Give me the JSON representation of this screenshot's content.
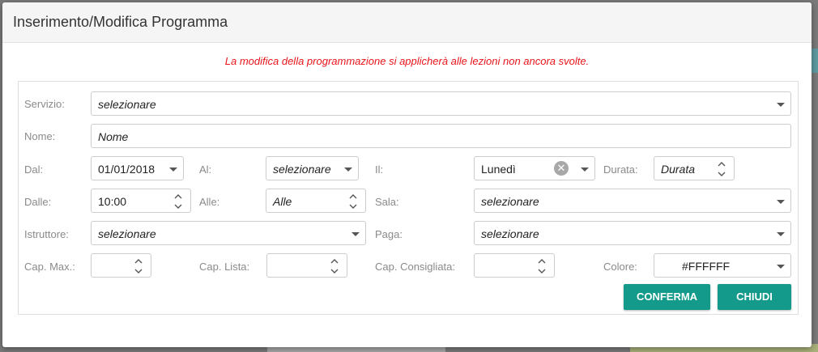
{
  "dialog": {
    "title": "Inserimento/Modifica Programma",
    "notice": "La modifica della programmazione si applicherà alle lezioni non ancora svolte."
  },
  "form": {
    "servizio": {
      "label": "Servizio:",
      "value": "selezionare"
    },
    "nome": {
      "label": "Nome:",
      "placeholder": "Nome"
    },
    "dal": {
      "label": "Dal:",
      "value": "01/01/2018"
    },
    "al": {
      "label": "Al:",
      "value": "selezionare"
    },
    "il": {
      "label": "Il:",
      "value": "Lunedì"
    },
    "durata": {
      "label": "Durata:",
      "placeholder": "Durata"
    },
    "dalle": {
      "label": "Dalle:",
      "value": "10:00"
    },
    "alle": {
      "label": "Alle:",
      "placeholder": "Alle"
    },
    "sala": {
      "label": "Sala:",
      "value": "selezionare"
    },
    "istruttore": {
      "label": "Istruttore:",
      "value": "selezionare"
    },
    "paga": {
      "label": "Paga:",
      "value": "selezionare"
    },
    "cap_max": {
      "label": "Cap. Max.:",
      "value": ""
    },
    "cap_lista": {
      "label": "Cap. Lista:",
      "value": ""
    },
    "cap_consigliata": {
      "label": "Cap. Consigliata:",
      "value": ""
    },
    "colore": {
      "label": "Colore:",
      "value": "#FFFFFF"
    }
  },
  "buttons": {
    "confirm": "CONFERMA",
    "close": "CHIUDI"
  },
  "colors": {
    "accent": "#139a8a",
    "notice": "#e8151b"
  }
}
